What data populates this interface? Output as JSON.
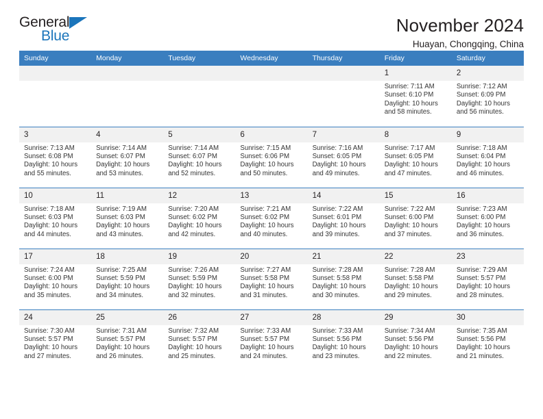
{
  "brand": {
    "name_top": "General",
    "name_bottom": "Blue",
    "accent_color": "#1b75bb"
  },
  "header": {
    "title": "November 2024",
    "subtitle": "Huayan, Chongqing, China"
  },
  "calendar": {
    "header_bg": "#3a7ebf",
    "daynum_bg": "#f1f1f1",
    "weekdays": [
      "Sunday",
      "Monday",
      "Tuesday",
      "Wednesday",
      "Thursday",
      "Friday",
      "Saturday"
    ],
    "labels": {
      "sunrise": "Sunrise:",
      "sunset": "Sunset:",
      "daylight": "Daylight:"
    },
    "weeks": [
      [
        {
          "day": "",
          "empty": true
        },
        {
          "day": "",
          "empty": true
        },
        {
          "day": "",
          "empty": true
        },
        {
          "day": "",
          "empty": true
        },
        {
          "day": "",
          "empty": true
        },
        {
          "day": "1",
          "sunrise": "Sunrise: 7:11 AM",
          "sunset": "Sunset: 6:10 PM",
          "daylight": "Daylight: 10 hours and 58 minutes."
        },
        {
          "day": "2",
          "sunrise": "Sunrise: 7:12 AM",
          "sunset": "Sunset: 6:09 PM",
          "daylight": "Daylight: 10 hours and 56 minutes."
        }
      ],
      [
        {
          "day": "3",
          "sunrise": "Sunrise: 7:13 AM",
          "sunset": "Sunset: 6:08 PM",
          "daylight": "Daylight: 10 hours and 55 minutes."
        },
        {
          "day": "4",
          "sunrise": "Sunrise: 7:14 AM",
          "sunset": "Sunset: 6:07 PM",
          "daylight": "Daylight: 10 hours and 53 minutes."
        },
        {
          "day": "5",
          "sunrise": "Sunrise: 7:14 AM",
          "sunset": "Sunset: 6:07 PM",
          "daylight": "Daylight: 10 hours and 52 minutes."
        },
        {
          "day": "6",
          "sunrise": "Sunrise: 7:15 AM",
          "sunset": "Sunset: 6:06 PM",
          "daylight": "Daylight: 10 hours and 50 minutes."
        },
        {
          "day": "7",
          "sunrise": "Sunrise: 7:16 AM",
          "sunset": "Sunset: 6:05 PM",
          "daylight": "Daylight: 10 hours and 49 minutes."
        },
        {
          "day": "8",
          "sunrise": "Sunrise: 7:17 AM",
          "sunset": "Sunset: 6:05 PM",
          "daylight": "Daylight: 10 hours and 47 minutes."
        },
        {
          "day": "9",
          "sunrise": "Sunrise: 7:18 AM",
          "sunset": "Sunset: 6:04 PM",
          "daylight": "Daylight: 10 hours and 46 minutes."
        }
      ],
      [
        {
          "day": "10",
          "sunrise": "Sunrise: 7:18 AM",
          "sunset": "Sunset: 6:03 PM",
          "daylight": "Daylight: 10 hours and 44 minutes."
        },
        {
          "day": "11",
          "sunrise": "Sunrise: 7:19 AM",
          "sunset": "Sunset: 6:03 PM",
          "daylight": "Daylight: 10 hours and 43 minutes."
        },
        {
          "day": "12",
          "sunrise": "Sunrise: 7:20 AM",
          "sunset": "Sunset: 6:02 PM",
          "daylight": "Daylight: 10 hours and 42 minutes."
        },
        {
          "day": "13",
          "sunrise": "Sunrise: 7:21 AM",
          "sunset": "Sunset: 6:02 PM",
          "daylight": "Daylight: 10 hours and 40 minutes."
        },
        {
          "day": "14",
          "sunrise": "Sunrise: 7:22 AM",
          "sunset": "Sunset: 6:01 PM",
          "daylight": "Daylight: 10 hours and 39 minutes."
        },
        {
          "day": "15",
          "sunrise": "Sunrise: 7:22 AM",
          "sunset": "Sunset: 6:00 PM",
          "daylight": "Daylight: 10 hours and 37 minutes."
        },
        {
          "day": "16",
          "sunrise": "Sunrise: 7:23 AM",
          "sunset": "Sunset: 6:00 PM",
          "daylight": "Daylight: 10 hours and 36 minutes."
        }
      ],
      [
        {
          "day": "17",
          "sunrise": "Sunrise: 7:24 AM",
          "sunset": "Sunset: 6:00 PM",
          "daylight": "Daylight: 10 hours and 35 minutes."
        },
        {
          "day": "18",
          "sunrise": "Sunrise: 7:25 AM",
          "sunset": "Sunset: 5:59 PM",
          "daylight": "Daylight: 10 hours and 34 minutes."
        },
        {
          "day": "19",
          "sunrise": "Sunrise: 7:26 AM",
          "sunset": "Sunset: 5:59 PM",
          "daylight": "Daylight: 10 hours and 32 minutes."
        },
        {
          "day": "20",
          "sunrise": "Sunrise: 7:27 AM",
          "sunset": "Sunset: 5:58 PM",
          "daylight": "Daylight: 10 hours and 31 minutes."
        },
        {
          "day": "21",
          "sunrise": "Sunrise: 7:28 AM",
          "sunset": "Sunset: 5:58 PM",
          "daylight": "Daylight: 10 hours and 30 minutes."
        },
        {
          "day": "22",
          "sunrise": "Sunrise: 7:28 AM",
          "sunset": "Sunset: 5:58 PM",
          "daylight": "Daylight: 10 hours and 29 minutes."
        },
        {
          "day": "23",
          "sunrise": "Sunrise: 7:29 AM",
          "sunset": "Sunset: 5:57 PM",
          "daylight": "Daylight: 10 hours and 28 minutes."
        }
      ],
      [
        {
          "day": "24",
          "sunrise": "Sunrise: 7:30 AM",
          "sunset": "Sunset: 5:57 PM",
          "daylight": "Daylight: 10 hours and 27 minutes."
        },
        {
          "day": "25",
          "sunrise": "Sunrise: 7:31 AM",
          "sunset": "Sunset: 5:57 PM",
          "daylight": "Daylight: 10 hours and 26 minutes."
        },
        {
          "day": "26",
          "sunrise": "Sunrise: 7:32 AM",
          "sunset": "Sunset: 5:57 PM",
          "daylight": "Daylight: 10 hours and 25 minutes."
        },
        {
          "day": "27",
          "sunrise": "Sunrise: 7:33 AM",
          "sunset": "Sunset: 5:57 PM",
          "daylight": "Daylight: 10 hours and 24 minutes."
        },
        {
          "day": "28",
          "sunrise": "Sunrise: 7:33 AM",
          "sunset": "Sunset: 5:56 PM",
          "daylight": "Daylight: 10 hours and 23 minutes."
        },
        {
          "day": "29",
          "sunrise": "Sunrise: 7:34 AM",
          "sunset": "Sunset: 5:56 PM",
          "daylight": "Daylight: 10 hours and 22 minutes."
        },
        {
          "day": "30",
          "sunrise": "Sunrise: 7:35 AM",
          "sunset": "Sunset: 5:56 PM",
          "daylight": "Daylight: 10 hours and 21 minutes."
        }
      ]
    ]
  }
}
